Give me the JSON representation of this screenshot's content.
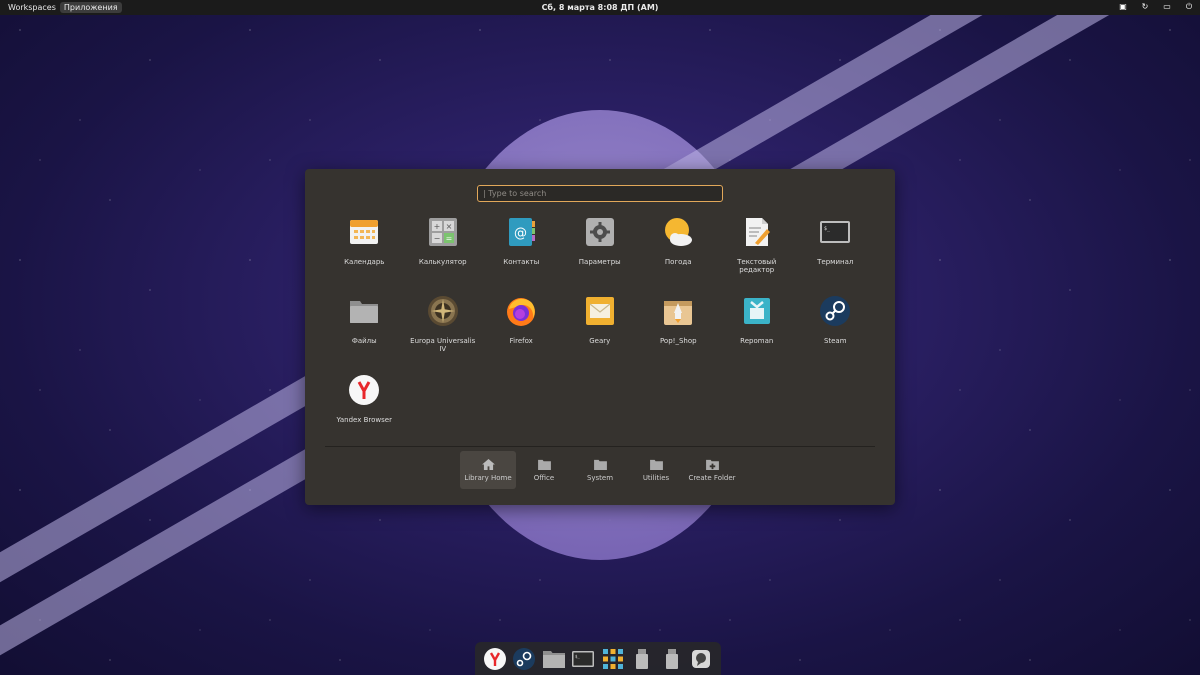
{
  "topbar": {
    "workspaces": "Workspaces",
    "apps": "Приложения",
    "clock": "Сб, 8 марта   8:08 ДП (AM)"
  },
  "search": {
    "placeholder": "| Type to search"
  },
  "apps": [
    {
      "label": "Календарь",
      "icon": "calendar-icon"
    },
    {
      "label": "Калькулятор",
      "icon": "calculator-icon"
    },
    {
      "label": "Контакты",
      "icon": "contacts-icon"
    },
    {
      "label": "Параметры",
      "icon": "settings-icon"
    },
    {
      "label": "Погода",
      "icon": "weather-icon"
    },
    {
      "label": "Текстовый редактор",
      "icon": "text-editor-icon"
    },
    {
      "label": "Терминал",
      "icon": "terminal-icon"
    },
    {
      "label": "Файлы",
      "icon": "files-icon"
    },
    {
      "label": "Europa Universalis IV",
      "icon": "europa-universalis-icon"
    },
    {
      "label": "Firefox",
      "icon": "firefox-icon"
    },
    {
      "label": "Geary",
      "icon": "geary-icon"
    },
    {
      "label": "Pop!_Shop",
      "icon": "pop-shop-icon"
    },
    {
      "label": "Repoman",
      "icon": "repoman-icon"
    },
    {
      "label": "Steam",
      "icon": "steam-icon"
    },
    {
      "label": "Yandex Browser",
      "icon": "yandex-browser-icon"
    }
  ],
  "folders": [
    {
      "label": "Library Home",
      "icon": "home-icon"
    },
    {
      "label": "Office",
      "icon": "folder-icon"
    },
    {
      "label": "System",
      "icon": "folder-icon"
    },
    {
      "label": "Utilities",
      "icon": "folder-icon"
    },
    {
      "label": "Create Folder",
      "icon": "folder-add-icon"
    }
  ],
  "colors": {
    "accent": "#e2a85a",
    "launcher_bg": "#36332f"
  }
}
